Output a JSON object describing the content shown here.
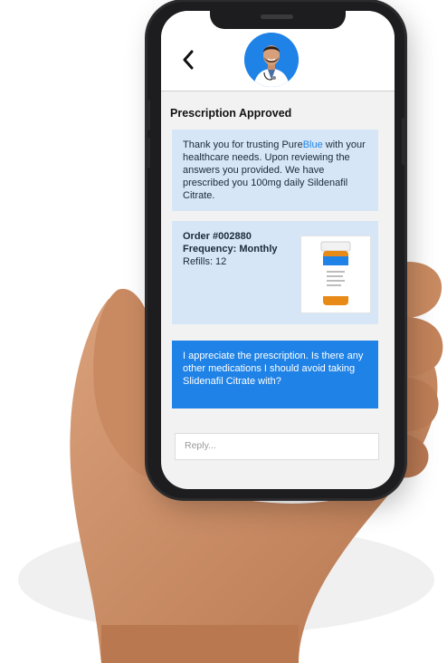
{
  "header": {
    "back_icon": "chevron-left-icon",
    "avatar": "doctor-avatar"
  },
  "chat": {
    "title": "Prescription Approved",
    "message1_prefix": "Thank you for trusting ",
    "brand_part1": "Pure",
    "brand_part2": "Blue",
    "message1_suffix": " with your healthcare needs. Upon reviewing the answers you provided. We have prescribed you 100mg daily Sildenafil Citrate.",
    "order": {
      "number": "Order #002880",
      "frequency": "Frequency: Monthly",
      "refills": "Refills: 12",
      "image": "medication-bottle-image"
    },
    "user_message": "I appreciate the prescription. Is there any other medications I should avoid taking Slidenafil Citrate with?",
    "reply_placeholder": "Reply..."
  },
  "colors": {
    "accent": "#1f82e6",
    "bubble_light": "#d6e6f7",
    "screen_bg": "#f2f2f2"
  }
}
